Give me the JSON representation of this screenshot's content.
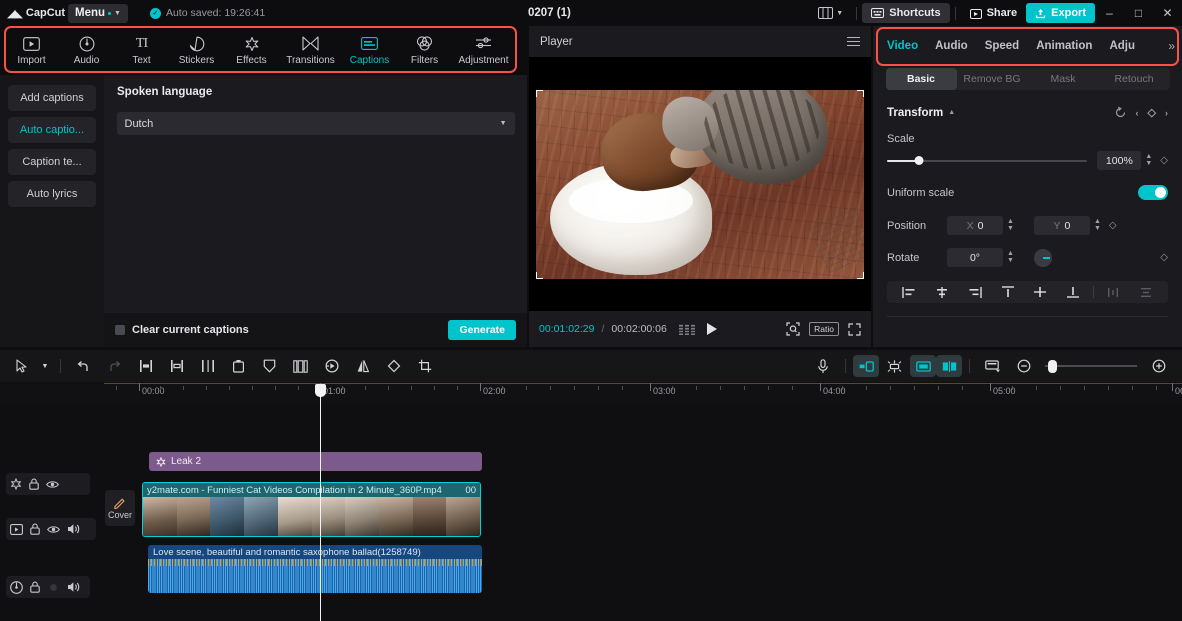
{
  "titlebar": {
    "logo": "CapCut",
    "menu_label": "Menu",
    "autosave": "Auto saved: 19:26:41",
    "project_title": "0207 (1)",
    "shortcuts_label": "Shortcuts",
    "share_label": "Share",
    "export_label": "Export",
    "minimize": "–",
    "maximize": "□",
    "close": "✕"
  },
  "mediabar": {
    "items": [
      {
        "label": "Import",
        "icon": "import-icon",
        "active": false
      },
      {
        "label": "Audio",
        "icon": "audio-icon",
        "active": false
      },
      {
        "label": "Text",
        "icon": "text-icon",
        "active": false
      },
      {
        "label": "Stickers",
        "icon": "stickers-icon",
        "active": false
      },
      {
        "label": "Effects",
        "icon": "effects-icon",
        "active": false
      },
      {
        "label": "Transitions",
        "icon": "transitions-icon",
        "active": false
      },
      {
        "label": "Captions",
        "icon": "captions-icon",
        "active": true
      },
      {
        "label": "Filters",
        "icon": "filters-icon",
        "active": false
      },
      {
        "label": "Adjustment",
        "icon": "adjustment-icon",
        "active": false
      }
    ]
  },
  "sidebar": {
    "items": [
      {
        "label": "Add captions",
        "active": false
      },
      {
        "label": "Auto captio...",
        "active": true
      },
      {
        "label": "Caption te...",
        "active": false
      },
      {
        "label": "Auto lyrics",
        "active": false
      }
    ]
  },
  "captions_panel": {
    "section_label": "Spoken language",
    "language_value": "Dutch",
    "clear_captions_label": "Clear current captions",
    "generate_label": "Generate"
  },
  "player": {
    "title": "Player",
    "current_time": "00:01:02:29",
    "time_separator": "/",
    "total_time": "00:02:00:06",
    "ratio_label": "Ratio"
  },
  "right_panel": {
    "tabs": [
      {
        "label": "Video",
        "active": true
      },
      {
        "label": "Audio",
        "active": false
      },
      {
        "label": "Speed",
        "active": false
      },
      {
        "label": "Animation",
        "active": false
      },
      {
        "label": "Adju",
        "active": false
      }
    ],
    "overflow": "»",
    "subtabs": [
      {
        "label": "Basic",
        "active": true
      },
      {
        "label": "Remove BG",
        "active": false
      },
      {
        "label": "Mask",
        "active": false
      },
      {
        "label": "Retouch",
        "active": false
      }
    ],
    "transform": {
      "title": "Transform",
      "scale_label": "Scale",
      "scale_value": "100%",
      "uniform_scale_label": "Uniform scale",
      "uniform_scale_on": true,
      "position_label": "Position",
      "position_x_axis": "X",
      "position_x_value": "0",
      "position_y_axis": "Y",
      "position_y_value": "0",
      "rotate_label": "Rotate",
      "rotate_value": "0°"
    }
  },
  "timeline": {
    "ruler_ticks": [
      "00:00",
      "01:00",
      "02:00",
      "03:00",
      "04:00",
      "05:00",
      "06"
    ],
    "tracks": [
      {
        "name": "effect-track",
        "clip_label": "Leak 2",
        "icons": [
          "sticker-icon",
          "lock-icon",
          "eye-icon"
        ]
      },
      {
        "name": "video-track",
        "clip_label": "y2mate.com - Funniest Cat Videos Compilation in 2 Minute_360P.mp4",
        "clip_label_extra": "00",
        "icons": [
          "video-icon",
          "lock-icon",
          "eye-icon",
          "speaker-icon"
        ]
      },
      {
        "name": "audio-track",
        "clip_label": "Love scene, beautiful and romantic saxophone ballad(1258749)",
        "icons": [
          "music-icon",
          "lock-icon",
          "speaker-icon"
        ]
      }
    ],
    "cover_label": "Cover"
  },
  "colors": {
    "accent": "#00c4cc",
    "highlight_box": "#f9524b",
    "effect_clip": "#7c5a8c",
    "video_clip": "#1d6670",
    "audio_clip": "#16477e"
  }
}
